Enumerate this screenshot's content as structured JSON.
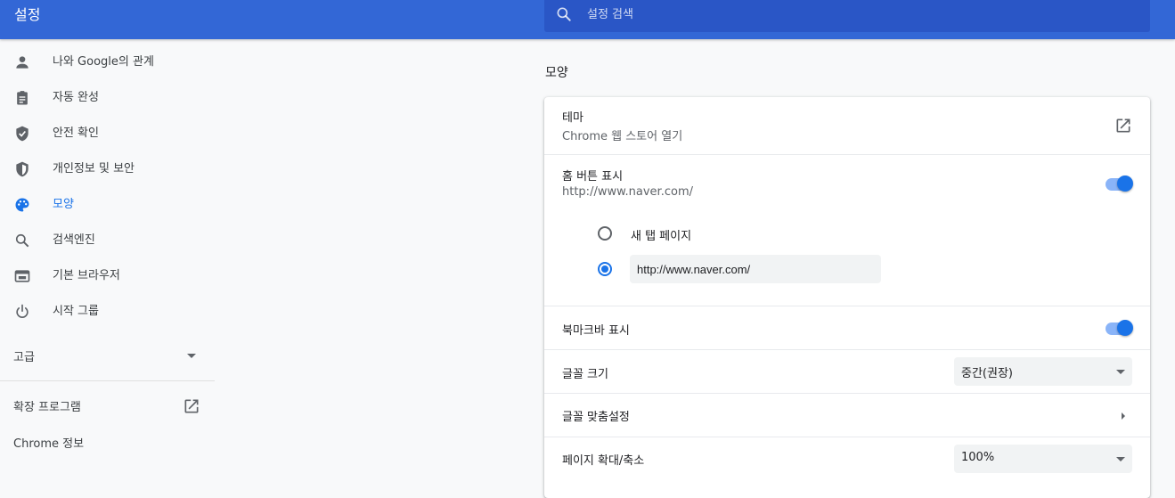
{
  "app": {
    "title": "설정"
  },
  "search": {
    "placeholder": "설정 검색"
  },
  "sidebar": {
    "items": [
      {
        "label": "나와 Google의 관계",
        "icon": "person-icon"
      },
      {
        "label": "자동 완성",
        "icon": "clipboard-icon"
      },
      {
        "label": "안전 확인",
        "icon": "shield-check-icon"
      },
      {
        "label": "개인정보 및 보안",
        "icon": "shield-icon"
      },
      {
        "label": "모양",
        "icon": "palette-icon",
        "active": true
      },
      {
        "label": "검색엔진",
        "icon": "search-icon"
      },
      {
        "label": "기본 브라우저",
        "icon": "browser-icon"
      },
      {
        "label": "시작 그룹",
        "icon": "power-icon"
      }
    ],
    "advanced_label": "고급",
    "extensions_label": "확장 프로그램",
    "about_label": "Chrome 정보"
  },
  "appearance": {
    "section_title": "모양",
    "theme": {
      "label": "테마",
      "sub": "Chrome 웹 스토어 열기"
    },
    "home_button": {
      "label": "홈 버튼 표시",
      "sub": "http://www.naver.com/",
      "enabled": true,
      "option_new_tab": "새 탭 페이지",
      "option_custom_url": "http://www.naver.com/",
      "selected": "custom"
    },
    "bookmarks_bar": {
      "label": "북마크바 표시",
      "enabled": true
    },
    "font_size": {
      "label": "글꼴 크기",
      "value": "중간(권장)"
    },
    "custom_fonts": {
      "label": "글꼴 맞춤설정"
    },
    "page_zoom": {
      "label": "페이지 확대/축소",
      "value": "100%"
    }
  },
  "colors": {
    "header": "#3367d6",
    "search": "#2a56c6",
    "accent": "#1a73e8",
    "toggle_track": "#8ab4f8"
  }
}
